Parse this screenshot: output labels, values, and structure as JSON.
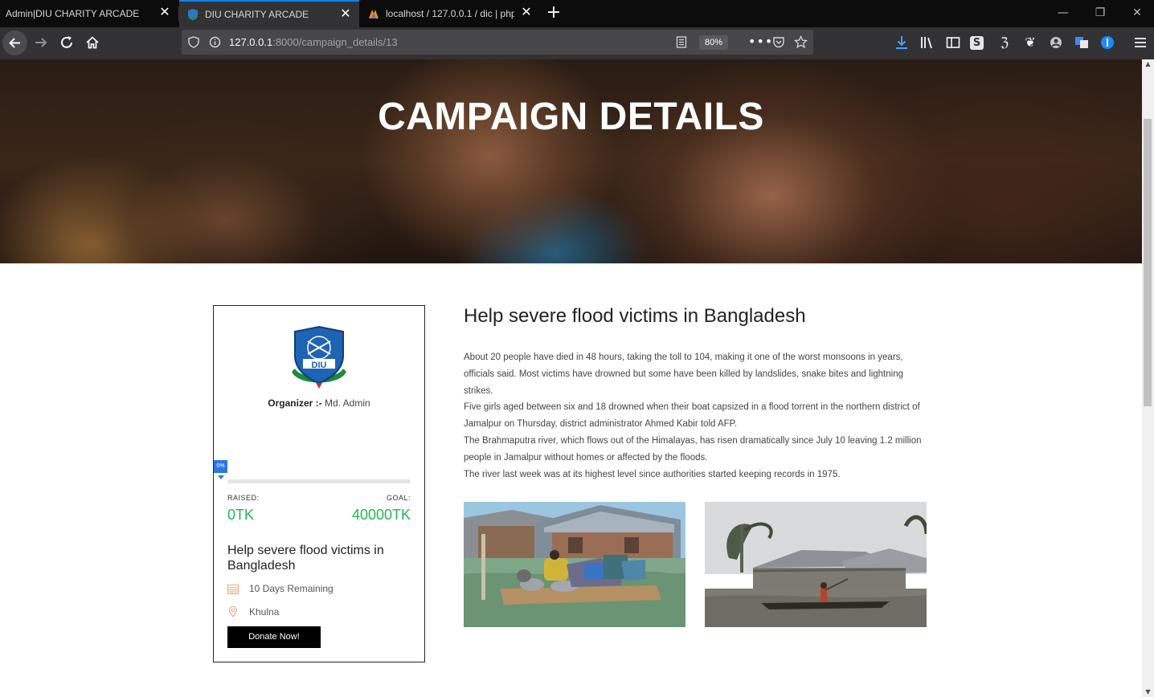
{
  "browser": {
    "tabs": [
      {
        "title": "Admin|DIU CHARITY ARCADE",
        "active": false
      },
      {
        "title": "DIU CHARITY ARCADE",
        "active": true
      },
      {
        "title": "localhost / 127.0.0.1 / dic | php",
        "active": false
      }
    ],
    "url_host": "127.0.0.1",
    "url_rest": ":8000/campaign_details/13",
    "zoom": "80%"
  },
  "hero": {
    "title": "CAMPAIGN DETAILS"
  },
  "card": {
    "organizer_label": "Organizer :-",
    "organizer_name": "Md. Admin",
    "progress_label": "0%",
    "progress_fraction": 0,
    "raised_label": "RAISED:",
    "goal_label": "GOAL:",
    "raised_value": "0TK",
    "goal_value": "40000TK",
    "title": "Help severe flood victims in Bangladesh",
    "days_remaining": "10 Days Remaining",
    "location": "Khulna",
    "donate_label": "Donate Now!"
  },
  "details": {
    "title": "Help severe flood victims in Bangladesh",
    "paragraphs": [
      "About 20 people have died in 48 hours, taking the toll to 104, making it one of the worst monsoons in years, officials said. Most victims have drowned but some have been killed by landslides, snake bites and lightning strikes.",
      "Five girls aged between six and 18 drowned when their boat capsized in a flood torrent in the northern district of Jamalpur on Thursday, district administrator Ahmed Kabir told AFP.",
      "The Brahmaputra river, which flows out of the Himalayas, has risen dramatically since July 10 leaving 1.2 million people in Jamalpur without homes or affected by the floods.",
      "The river last week was at its highest level since authorities started keeping records in 1975."
    ]
  },
  "colors": {
    "accent_green": "#22b455",
    "progress_blue": "#2b78e4",
    "browser_dark": "#0c0c0d"
  }
}
